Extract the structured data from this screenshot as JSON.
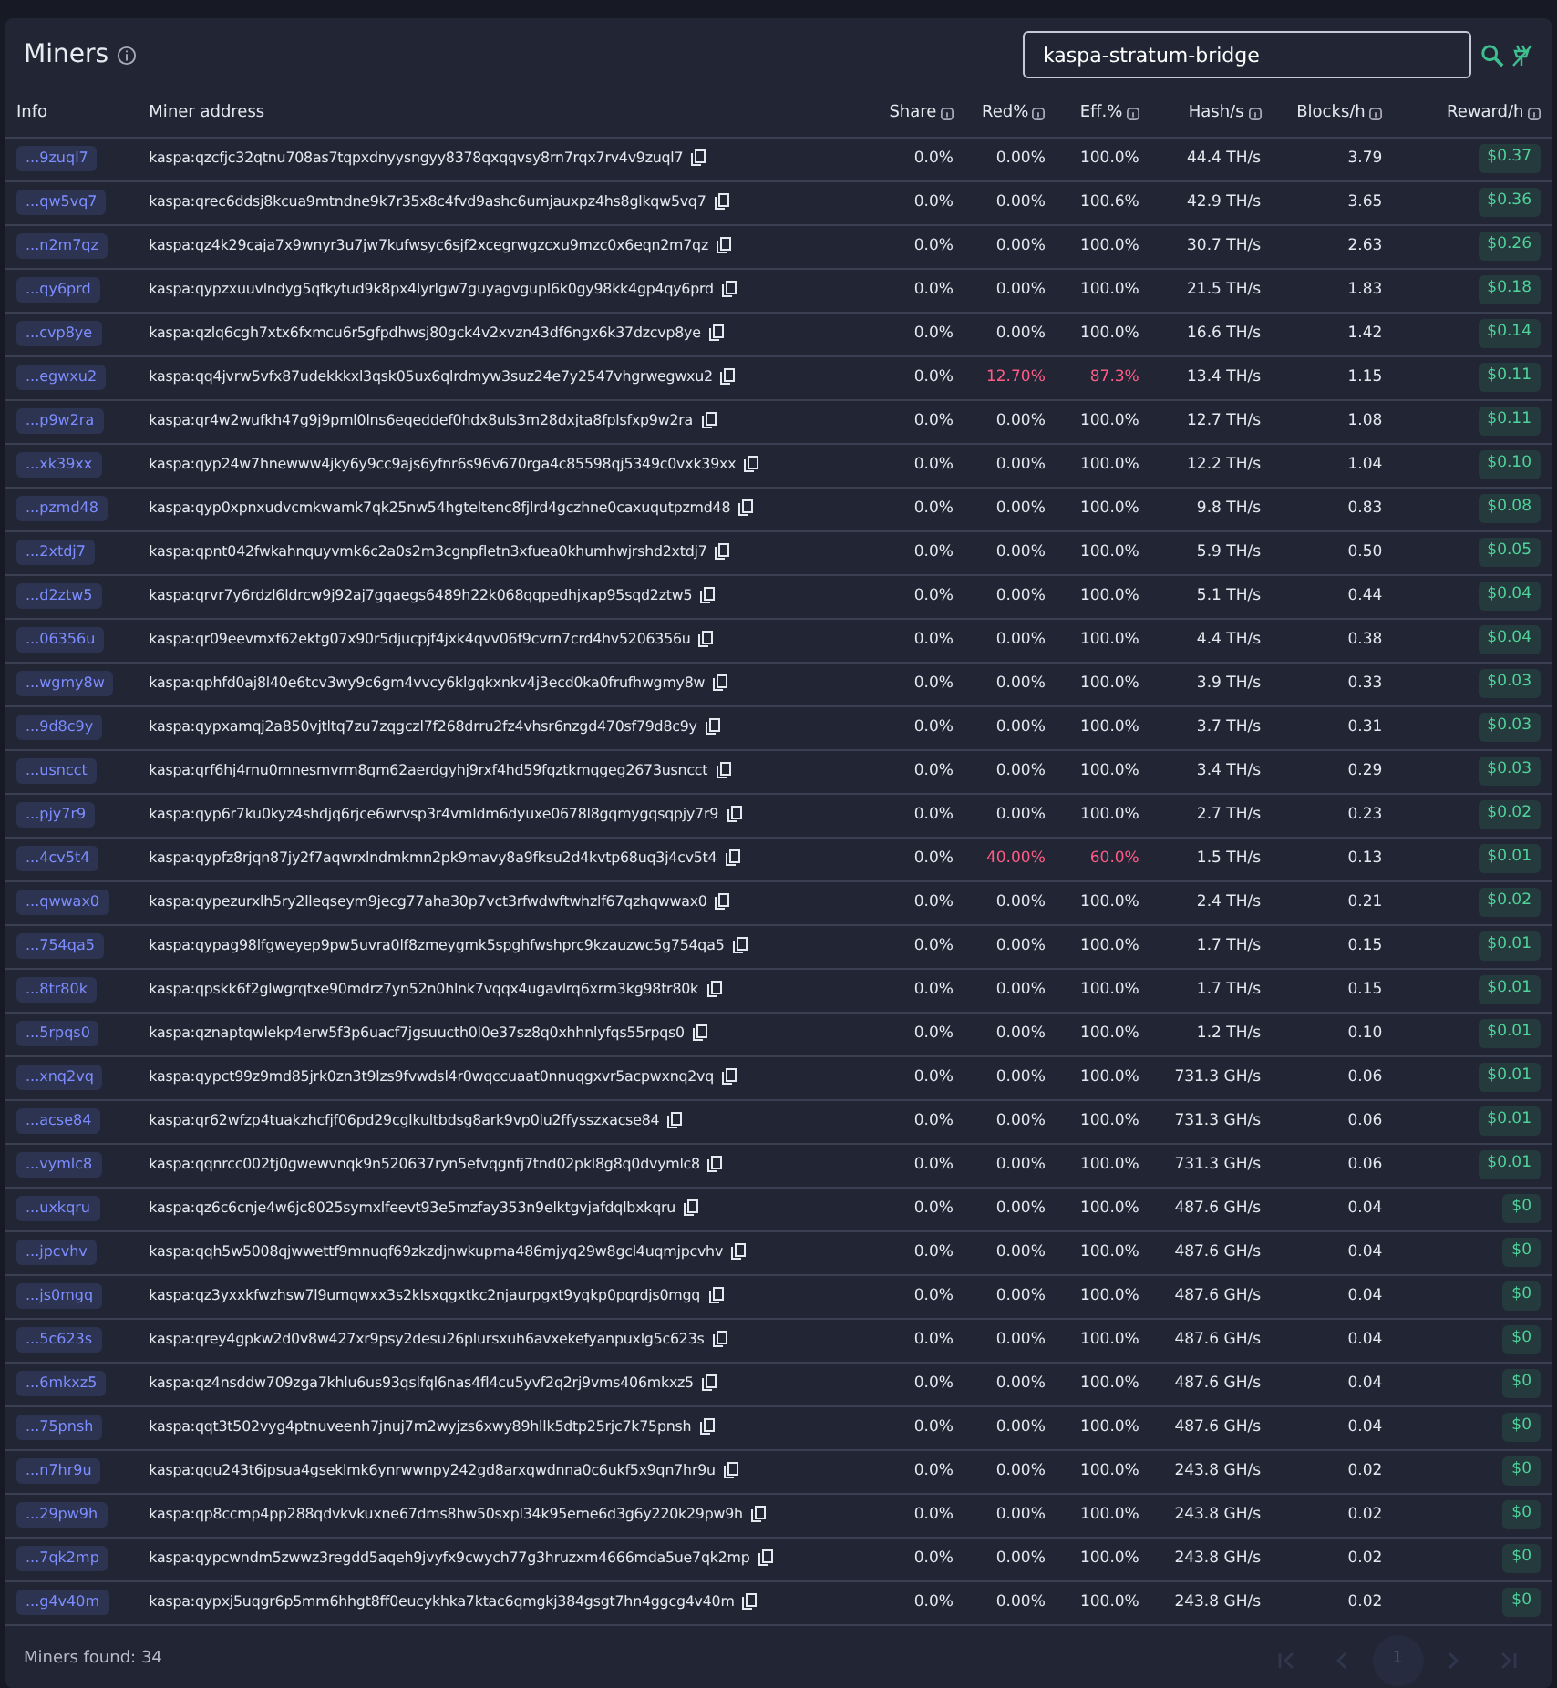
{
  "title": "Miners",
  "search": {
    "value": "kaspa-stratum-bridge"
  },
  "columns": [
    {
      "label": "Info",
      "info": false
    },
    {
      "label": "Miner address",
      "info": false
    },
    {
      "label": "Share",
      "info": true
    },
    {
      "label": "Red%",
      "info": true
    },
    {
      "label": "Eff.%",
      "info": true
    },
    {
      "label": "Hash/s",
      "info": true
    },
    {
      "label": "Blocks/h",
      "info": true
    },
    {
      "label": "Reward/h",
      "info": true
    }
  ],
  "rows": [
    {
      "info": "...9zuql7",
      "address": "kaspa:qzcfjc32qtnu708as7tqpxdnyysngyy8378qxqqvsy8rn7rqx7rv4v9zuql7",
      "share": "0.0%",
      "red": "0.00%",
      "eff": "100.0%",
      "hash": "44.4 TH/s",
      "blocks": "3.79",
      "reward": "$0.37",
      "warning": false
    },
    {
      "info": "...qw5vq7",
      "address": "kaspa:qrec6ddsj8kcua9mtndne9k7r35x8c4fvd9ashc6umjauxpz4hs8glkqw5vq7",
      "share": "0.0%",
      "red": "0.00%",
      "eff": "100.6%",
      "hash": "42.9 TH/s",
      "blocks": "3.65",
      "reward": "$0.36",
      "warning": false
    },
    {
      "info": "...n2m7qz",
      "address": "kaspa:qz4k29caja7x9wnyr3u7jw7kufwsyc6sjf2xcegrwgzcxu9mzc0x6eqn2m7qz",
      "share": "0.0%",
      "red": "0.00%",
      "eff": "100.0%",
      "hash": "30.7 TH/s",
      "blocks": "2.63",
      "reward": "$0.26",
      "warning": false
    },
    {
      "info": "...qy6prd",
      "address": "kaspa:qypzxuuvlndyg5qfkytud9k8px4lyrlgw7guyagvgupl6k0gy98kk4gp4qy6prd",
      "share": "0.0%",
      "red": "0.00%",
      "eff": "100.0%",
      "hash": "21.5 TH/s",
      "blocks": "1.83",
      "reward": "$0.18",
      "warning": false
    },
    {
      "info": "...cvp8ye",
      "address": "kaspa:qzlq6cgh7xtx6fxmcu6r5gfpdhwsj80gck4v2xvzn43df6ngx6k37dzcvp8ye",
      "share": "0.0%",
      "red": "0.00%",
      "eff": "100.0%",
      "hash": "16.6 TH/s",
      "blocks": "1.42",
      "reward": "$0.14",
      "warning": false
    },
    {
      "info": "...egwxu2",
      "address": "kaspa:qq4jvrw5vfx87udekkkxl3qsk05ux6qlrdmyw3suz24e7y2547vhgrwegwxu2",
      "share": "0.0%",
      "red": "12.70%",
      "eff": "87.3%",
      "hash": "13.4 TH/s",
      "blocks": "1.15",
      "reward": "$0.11",
      "warning": true
    },
    {
      "info": "...p9w2ra",
      "address": "kaspa:qr4w2wufkh47g9j9pml0lns6eqeddef0hdx8uls3m28dxjta8fplsfxp9w2ra",
      "share": "0.0%",
      "red": "0.00%",
      "eff": "100.0%",
      "hash": "12.7 TH/s",
      "blocks": "1.08",
      "reward": "$0.11",
      "warning": false
    },
    {
      "info": "...xk39xx",
      "address": "kaspa:qyp24w7hnewww4jky6y9cc9ajs6yfnr6s96v670rga4c85598qj5349c0vxk39xx",
      "share": "0.0%",
      "red": "0.00%",
      "eff": "100.0%",
      "hash": "12.2 TH/s",
      "blocks": "1.04",
      "reward": "$0.10",
      "warning": false
    },
    {
      "info": "...pzmd48",
      "address": "kaspa:qyp0xpnxudvcmkwamk7qk25nw54hgteltenc8fjlrd4gczhne0caxuqutpzmd48",
      "share": "0.0%",
      "red": "0.00%",
      "eff": "100.0%",
      "hash": "9.8 TH/s",
      "blocks": "0.83",
      "reward": "$0.08",
      "warning": false
    },
    {
      "info": "...2xtdj7",
      "address": "kaspa:qpnt042fwkahnquyvmk6c2a0s2m3cgnpfletn3xfuea0khumhwjrshd2xtdj7",
      "share": "0.0%",
      "red": "0.00%",
      "eff": "100.0%",
      "hash": "5.9 TH/s",
      "blocks": "0.50",
      "reward": "$0.05",
      "warning": false
    },
    {
      "info": "...d2ztw5",
      "address": "kaspa:qrvr7y6rdzl6ldrcw9j92aj7gqaegs6489h22k068qqpedhjxap95sqd2ztw5",
      "share": "0.0%",
      "red": "0.00%",
      "eff": "100.0%",
      "hash": "5.1 TH/s",
      "blocks": "0.44",
      "reward": "$0.04",
      "warning": false
    },
    {
      "info": "...06356u",
      "address": "kaspa:qr09eevmxf62ektg07x90r5djucpjf4jxk4qvv06f9cvrn7crd4hv5206356u",
      "share": "0.0%",
      "red": "0.00%",
      "eff": "100.0%",
      "hash": "4.4 TH/s",
      "blocks": "0.38",
      "reward": "$0.04",
      "warning": false
    },
    {
      "info": "...wgmy8w",
      "address": "kaspa:qphfd0aj8l40e6tcv3wy9c6gm4vvcy6klgqkxnkv4j3ecd0ka0frufhwgmy8w",
      "share": "0.0%",
      "red": "0.00%",
      "eff": "100.0%",
      "hash": "3.9 TH/s",
      "blocks": "0.33",
      "reward": "$0.03",
      "warning": false
    },
    {
      "info": "...9d8c9y",
      "address": "kaspa:qypxamqj2a850vjtltq7zu7zqgczl7f268drru2fz4vhsr6nzgd470sf79d8c9y",
      "share": "0.0%",
      "red": "0.00%",
      "eff": "100.0%",
      "hash": "3.7 TH/s",
      "blocks": "0.31",
      "reward": "$0.03",
      "warning": false
    },
    {
      "info": "...usncct",
      "address": "kaspa:qrf6hj4rnu0mnesmvrm8qm62aerdgyhj9rxf4hd59fqztkmqgeg2673usncct",
      "share": "0.0%",
      "red": "0.00%",
      "eff": "100.0%",
      "hash": "3.4 TH/s",
      "blocks": "0.29",
      "reward": "$0.03",
      "warning": false
    },
    {
      "info": "...pjy7r9",
      "address": "kaspa:qyp6r7ku0kyz4shdjq6rjce6wrvsp3r4vmldm6dyuxe0678l8gqmygqsqpjy7r9",
      "share": "0.0%",
      "red": "0.00%",
      "eff": "100.0%",
      "hash": "2.7 TH/s",
      "blocks": "0.23",
      "reward": "$0.02",
      "warning": false
    },
    {
      "info": "...4cv5t4",
      "address": "kaspa:qypfz8rjqn87jy2f7aqwrxlndmkmn2pk9mavy8a9fksu2d4kvtp68uq3j4cv5t4",
      "share": "0.0%",
      "red": "40.00%",
      "eff": "60.0%",
      "hash": "1.5 TH/s",
      "blocks": "0.13",
      "reward": "$0.01",
      "warning": true
    },
    {
      "info": "...qwwax0",
      "address": "kaspa:qypezurxlh5ry2lleqseym9jecg77aha30p7vct3rfwdwftwhzlf67qzhqwwax0",
      "share": "0.0%",
      "red": "0.00%",
      "eff": "100.0%",
      "hash": "2.4 TH/s",
      "blocks": "0.21",
      "reward": "$0.02",
      "warning": false
    },
    {
      "info": "...754qa5",
      "address": "kaspa:qypag98lfgweyep9pw5uvra0lf8zmeygmk5spghfwshprc9kzauzwc5g754qa5",
      "share": "0.0%",
      "red": "0.00%",
      "eff": "100.0%",
      "hash": "1.7 TH/s",
      "blocks": "0.15",
      "reward": "$0.01",
      "warning": false
    },
    {
      "info": "...8tr80k",
      "address": "kaspa:qpskk6f2glwgrqtxe90mdrz7yn52n0hlnk7vqqx4ugavlrq6xrm3kg98tr80k",
      "share": "0.0%",
      "red": "0.00%",
      "eff": "100.0%",
      "hash": "1.7 TH/s",
      "blocks": "0.15",
      "reward": "$0.01",
      "warning": false
    },
    {
      "info": "...5rpqs0",
      "address": "kaspa:qznaptqwlekp4erw5f3p6uacf7jgsuucth0l0e37sz8q0xhhnlyfqs55rpqs0",
      "share": "0.0%",
      "red": "0.00%",
      "eff": "100.0%",
      "hash": "1.2 TH/s",
      "blocks": "0.10",
      "reward": "$0.01",
      "warning": false
    },
    {
      "info": "...xnq2vq",
      "address": "kaspa:qypct99z9md85jrk0zn3t9lzs9fvwdsl4r0wqccuaat0nnuqgxvr5acpwxnq2vq",
      "share": "0.0%",
      "red": "0.00%",
      "eff": "100.0%",
      "hash": "731.3 GH/s",
      "blocks": "0.06",
      "reward": "$0.01",
      "warning": false
    },
    {
      "info": "...acse84",
      "address": "kaspa:qr62wfzp4tuakzhcfjf06pd29cglkultbdsg8ark9vp0lu2ffysszxacse84",
      "share": "0.0%",
      "red": "0.00%",
      "eff": "100.0%",
      "hash": "731.3 GH/s",
      "blocks": "0.06",
      "reward": "$0.01",
      "warning": false
    },
    {
      "info": "...vymlc8",
      "address": "kaspa:qqnrcc002tj0gwewvnqk9n520637ryn5efvqgnfj7tnd02pkl8g8q0dvymlc8",
      "share": "0.0%",
      "red": "0.00%",
      "eff": "100.0%",
      "hash": "731.3 GH/s",
      "blocks": "0.06",
      "reward": "$0.01",
      "warning": false
    },
    {
      "info": "...uxkqru",
      "address": "kaspa:qz6c6cnje4w6jc8025symxlfeevt93e5mzfay353n9elktgvjafdqlbxkqru",
      "share": "0.0%",
      "red": "0.00%",
      "eff": "100.0%",
      "hash": "487.6 GH/s",
      "blocks": "0.04",
      "reward": "$0",
      "warning": false
    },
    {
      "info": "...jpcvhv",
      "address": "kaspa:qqh5w5008qjwwettf9mnuqf69zkzdjnwkupma486mjyq29w8gcl4uqmjpcvhv",
      "share": "0.0%",
      "red": "0.00%",
      "eff": "100.0%",
      "hash": "487.6 GH/s",
      "blocks": "0.04",
      "reward": "$0",
      "warning": false
    },
    {
      "info": "...js0mgq",
      "address": "kaspa:qz3yxxkfwzhsw7l9umqwxx3s2klsxqgxtkc2njaurpgxt9yqkp0pqrdjs0mgq",
      "share": "0.0%",
      "red": "0.00%",
      "eff": "100.0%",
      "hash": "487.6 GH/s",
      "blocks": "0.04",
      "reward": "$0",
      "warning": false
    },
    {
      "info": "...5c623s",
      "address": "kaspa:qrey4gpkw2d0v8w427xr9psy2desu26plursxuh6avxekefyanpuxlg5c623s",
      "share": "0.0%",
      "red": "0.00%",
      "eff": "100.0%",
      "hash": "487.6 GH/s",
      "blocks": "0.04",
      "reward": "$0",
      "warning": false
    },
    {
      "info": "...6mkxz5",
      "address": "kaspa:qz4nsddw709zga7khlu6us93qslfql6nas4fl4cu5yvf2q2rj9vms406mkxz5",
      "share": "0.0%",
      "red": "0.00%",
      "eff": "100.0%",
      "hash": "487.6 GH/s",
      "blocks": "0.04",
      "reward": "$0",
      "warning": false
    },
    {
      "info": "...75pnsh",
      "address": "kaspa:qqt3t502vyg4ptnuveenh7jnuj7m2wyjzs6xwy89hllk5dtp25rjc7k75pnsh",
      "share": "0.0%",
      "red": "0.00%",
      "eff": "100.0%",
      "hash": "487.6 GH/s",
      "blocks": "0.04",
      "reward": "$0",
      "warning": false
    },
    {
      "info": "...n7hr9u",
      "address": "kaspa:qqu243t6jpsua4gseklmk6ynrwwnpy242gd8arxqwdnna0c6ukf5x9qn7hr9u",
      "share": "0.0%",
      "red": "0.00%",
      "eff": "100.0%",
      "hash": "243.8 GH/s",
      "blocks": "0.02",
      "reward": "$0",
      "warning": false
    },
    {
      "info": "...29pw9h",
      "address": "kaspa:qp8ccmp4pp288qdvkvkuxne67dms8hw50sxpl34k95eme6d3g6y220k29pw9h",
      "share": "0.0%",
      "red": "0.00%",
      "eff": "100.0%",
      "hash": "243.8 GH/s",
      "blocks": "0.02",
      "reward": "$0",
      "warning": false
    },
    {
      "info": "...7qk2mp",
      "address": "kaspa:qypcwndm5zwwz3regdd5aqeh9jvyfx9cwych77g3hruzxm4666mda5ue7qk2mp",
      "share": "0.0%",
      "red": "0.00%",
      "eff": "100.0%",
      "hash": "243.8 GH/s",
      "blocks": "0.02",
      "reward": "$0",
      "warning": false
    },
    {
      "info": "...g4v40m",
      "address": "kaspa:qypxj5uqgr6p5mm6hhgt8ff0eucykhka7ktac6qmgkj384gsgt7hn4ggcg4v40m",
      "share": "0.0%",
      "red": "0.00%",
      "eff": "100.0%",
      "hash": "243.8 GH/s",
      "blocks": "0.02",
      "reward": "$0",
      "warning": false
    }
  ],
  "footer": "Miners found: 34",
  "pagination": [
    {
      "kind": "first",
      "disabled": true
    },
    {
      "kind": "prev",
      "disabled": true
    },
    {
      "kind": "page",
      "label": "1",
      "selected": true
    },
    {
      "kind": "next",
      "disabled": true
    },
    {
      "kind": "last",
      "disabled": true
    }
  ]
}
